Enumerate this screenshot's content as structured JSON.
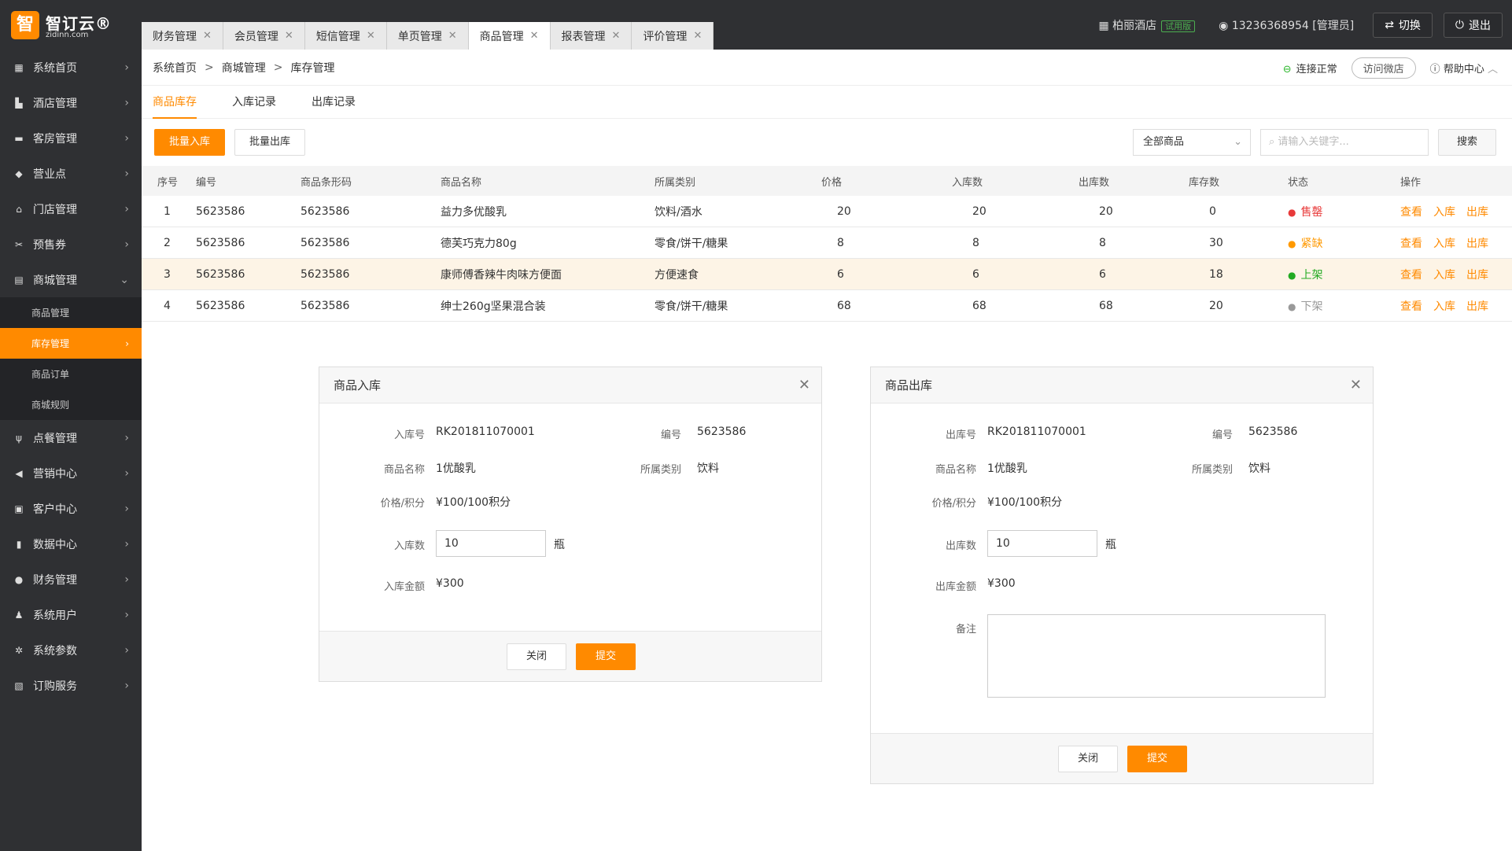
{
  "brand": {
    "logo_char": "智",
    "name": "智订云®",
    "domain": "zidinn.com"
  },
  "tabs": [
    {
      "label": "财务管理"
    },
    {
      "label": "会员管理"
    },
    {
      "label": "短信管理"
    },
    {
      "label": "单页管理"
    },
    {
      "label": "商品管理"
    },
    {
      "label": "报表管理"
    },
    {
      "label": "评价管理"
    }
  ],
  "topbar": {
    "hotel": "柏丽酒店",
    "trial": "试用版",
    "user": "13236368954 [管理员]",
    "switch": "切换",
    "logout": "退出"
  },
  "sidebar": {
    "items": [
      {
        "label": "系统首页",
        "icon": "grid-icon"
      },
      {
        "label": "酒店管理",
        "icon": "hotel-icon"
      },
      {
        "label": "客房管理",
        "icon": "bed-icon"
      },
      {
        "label": "营业点",
        "icon": "box-icon"
      },
      {
        "label": "门店管理",
        "icon": "home-icon"
      },
      {
        "label": "预售券",
        "icon": "ticket-icon"
      },
      {
        "label": "商城管理",
        "icon": "store-icon"
      }
    ],
    "sub": [
      {
        "label": "商品管理"
      },
      {
        "label": "库存管理"
      },
      {
        "label": "商品订单"
      },
      {
        "label": "商城规则"
      }
    ],
    "items2": [
      {
        "label": "点餐管理",
        "icon": "fork-icon"
      },
      {
        "label": "营销中心",
        "icon": "megaphone-icon"
      },
      {
        "label": "客户中心",
        "icon": "contact-icon"
      },
      {
        "label": "数据中心",
        "icon": "chart-icon"
      },
      {
        "label": "财务管理",
        "icon": "coin-icon"
      },
      {
        "label": "系统用户",
        "icon": "user-icon"
      },
      {
        "label": "系统参数",
        "icon": "gear-icon"
      },
      {
        "label": "订购服务",
        "icon": "cart-icon"
      }
    ]
  },
  "breadcrumb": {
    "home": "系统首页",
    "mall": "商城管理",
    "current": "库存管理"
  },
  "header_right": {
    "status": "连接正常",
    "visit": "访问微店",
    "help": "帮助中心"
  },
  "subtabs": [
    {
      "label": "商品库存"
    },
    {
      "label": "入库记录"
    },
    {
      "label": "出库记录"
    }
  ],
  "toolbar": {
    "batch_in": "批量入库",
    "batch_out": "批量出库",
    "select_value": "全部商品",
    "search_placeholder": "请输入关键字...",
    "search_button": "搜索"
  },
  "table": {
    "headers": [
      "序号",
      "编号",
      "商品条形码",
      "商品名称",
      "所属类别",
      "价格",
      "入库数",
      "出库数",
      "库存数",
      "状态",
      "操作"
    ],
    "rows": [
      {
        "no": "1",
        "code": "5623586",
        "barcode": "5623586",
        "name": "益力多优酸乳",
        "cat": "饮料/酒水",
        "price": "20",
        "in": "20",
        "out": "20",
        "stock": "0",
        "status": "售罄",
        "status_color": "#e83a3a"
      },
      {
        "no": "2",
        "code": "5623586",
        "barcode": "5623586",
        "name": "德芙巧克力80g",
        "cat": "零食/饼干/糖果",
        "price": "8",
        "in": "8",
        "out": "8",
        "stock": "30",
        "status": "紧缺",
        "status_color": "#ff9900"
      },
      {
        "no": "3",
        "code": "5623586",
        "barcode": "5623586",
        "name": "康师傅香辣牛肉味方便面",
        "cat": "方便速食",
        "price": "6",
        "in": "6",
        "out": "6",
        "stock": "18",
        "status": "上架",
        "status_color": "#22aa22"
      },
      {
        "no": "4",
        "code": "5623586",
        "barcode": "5623586",
        "name": "绅士260g坚果混合装",
        "cat": "零食/饼干/糖果",
        "price": "68",
        "in": "68",
        "out": "68",
        "stock": "20",
        "status": "下架",
        "status_color": "#999999"
      }
    ],
    "ops": {
      "view": "查看",
      "in": "入库",
      "out": "出库"
    }
  },
  "modal_in": {
    "title": "商品入库",
    "l_no": "入库号",
    "v_no": "RK201811070001",
    "l_code": "编号",
    "v_code": "5623586",
    "l_name": "商品名称",
    "v_name": "1优酸乳",
    "l_cat": "所属类别",
    "v_cat": "饮料",
    "l_price": "价格/积分",
    "v_price": "¥100/100积分",
    "l_qty": "入库数",
    "v_qty": "10",
    "unit": "瓶",
    "l_amount": "入库金额",
    "v_amount": "¥300",
    "close": "关闭",
    "submit": "提交"
  },
  "modal_out": {
    "title": "商品出库",
    "l_no": "出库号",
    "v_no": "RK201811070001",
    "l_code": "编号",
    "v_code": "5623586",
    "l_name": "商品名称",
    "v_name": "1优酸乳",
    "l_cat": "所属类别",
    "v_cat": "饮料",
    "l_price": "价格/积分",
    "v_price": "¥100/100积分",
    "l_qty": "出库数",
    "v_qty": "10",
    "unit": "瓶",
    "l_amount": "出库金额",
    "v_amount": "¥300",
    "l_note": "备注",
    "close": "关闭",
    "submit": "提交"
  }
}
